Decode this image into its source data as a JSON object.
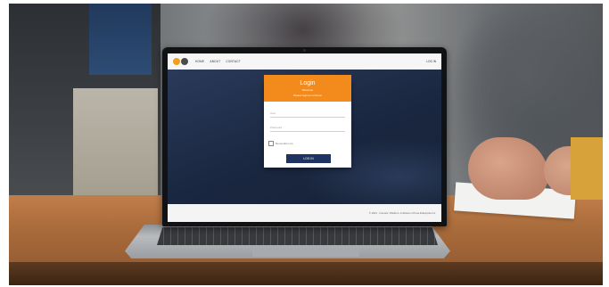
{
  "colors": {
    "accent_orange": "#f28a1c",
    "button_navy": "#1e3361",
    "site_background": "#1b2a44",
    "logo_orange": "#f0a020",
    "logo_dark": "#4b4b4b"
  },
  "site": {
    "header": {
      "nav": [
        "HOME",
        "ABOUT",
        "CONTACT"
      ],
      "login_link": "LOG IN"
    },
    "login": {
      "title": "Login",
      "subtitle_line1": "Welcome",
      "subtitle_line2": "Please login to continue",
      "user_placeholder": "User",
      "password_placeholder": "Password",
      "remember_label": "Remember me",
      "button_label": "LOG IN"
    },
    "footer": {
      "copyright": "© 2021 · Inventor. Platform. A division of Fore Enterprise Inc."
    }
  }
}
